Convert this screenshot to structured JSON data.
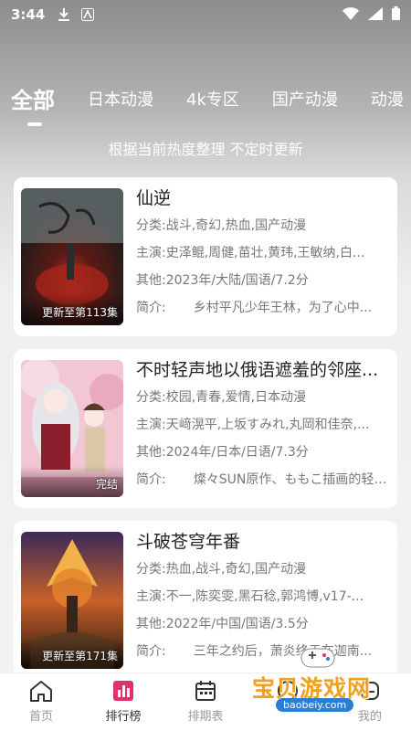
{
  "status_bar": {
    "time": "3:44"
  },
  "tabs": [
    {
      "label": "全部",
      "active": true
    },
    {
      "label": "日本动漫"
    },
    {
      "label": "4k专区"
    },
    {
      "label": "国产动漫"
    },
    {
      "label": "动漫"
    }
  ],
  "subtitle": "根据当前热度整理 不定时更新",
  "items": [
    {
      "title": "仙逆",
      "badge": "更新至第113集",
      "category_label": "分类:",
      "category": "战斗,奇幻,热血,国产动漫",
      "cast_label": "主演:",
      "cast": "史泽鲲,周健,苗壮,黄玮,王敏纳,白...",
      "other_label": "其他:",
      "other": "2023年/大陆/国语/7.2分",
      "intro_label": "简介:",
      "intro": "乡村平凡少年王林，为了心中..."
    },
    {
      "title": "不时轻声地以俄语遮羞的邻座...",
      "badge": "完结",
      "category_label": "分类:",
      "category": "校园,青春,爱情,日本动漫",
      "cast_label": "主演:",
      "cast": "天﨑滉平,上坂すみれ,丸岡和佳奈,...",
      "other_label": "其他:",
      "other": "2024年/日本/日语/7.3分",
      "intro_label": "简介:",
      "intro": "燦々SUN原作、ももこ插画的轻小..."
    },
    {
      "title": "斗破苍穹年番",
      "badge": "更新至第171集",
      "category_label": "分类:",
      "category": "热血,战斗,奇幻,国产动漫",
      "cast_label": "主演:",
      "cast": "不一,陈奕雯,黑石稔,郭鸿博,v17-...",
      "other_label": "其他:",
      "other": "2022年/中国/国语/3.5分",
      "intro_label": "简介:",
      "intro": "三年之约后，萧炎终于在迦南..."
    }
  ],
  "bottom_nav": [
    {
      "label": "首页",
      "icon": "home-icon"
    },
    {
      "label": "排行榜",
      "icon": "ranking-icon",
      "active": true
    },
    {
      "label": "排期表",
      "icon": "calendar-icon"
    },
    {
      "label": "",
      "icon": "game-icon"
    },
    {
      "label": "我的",
      "icon": "profile-icon"
    }
  ],
  "watermark": {
    "text": "宝贝游戏网",
    "url": "baobeiy.com"
  },
  "colors": {
    "accent": "#e0336b",
    "text": "#222222",
    "muted": "#777777"
  }
}
